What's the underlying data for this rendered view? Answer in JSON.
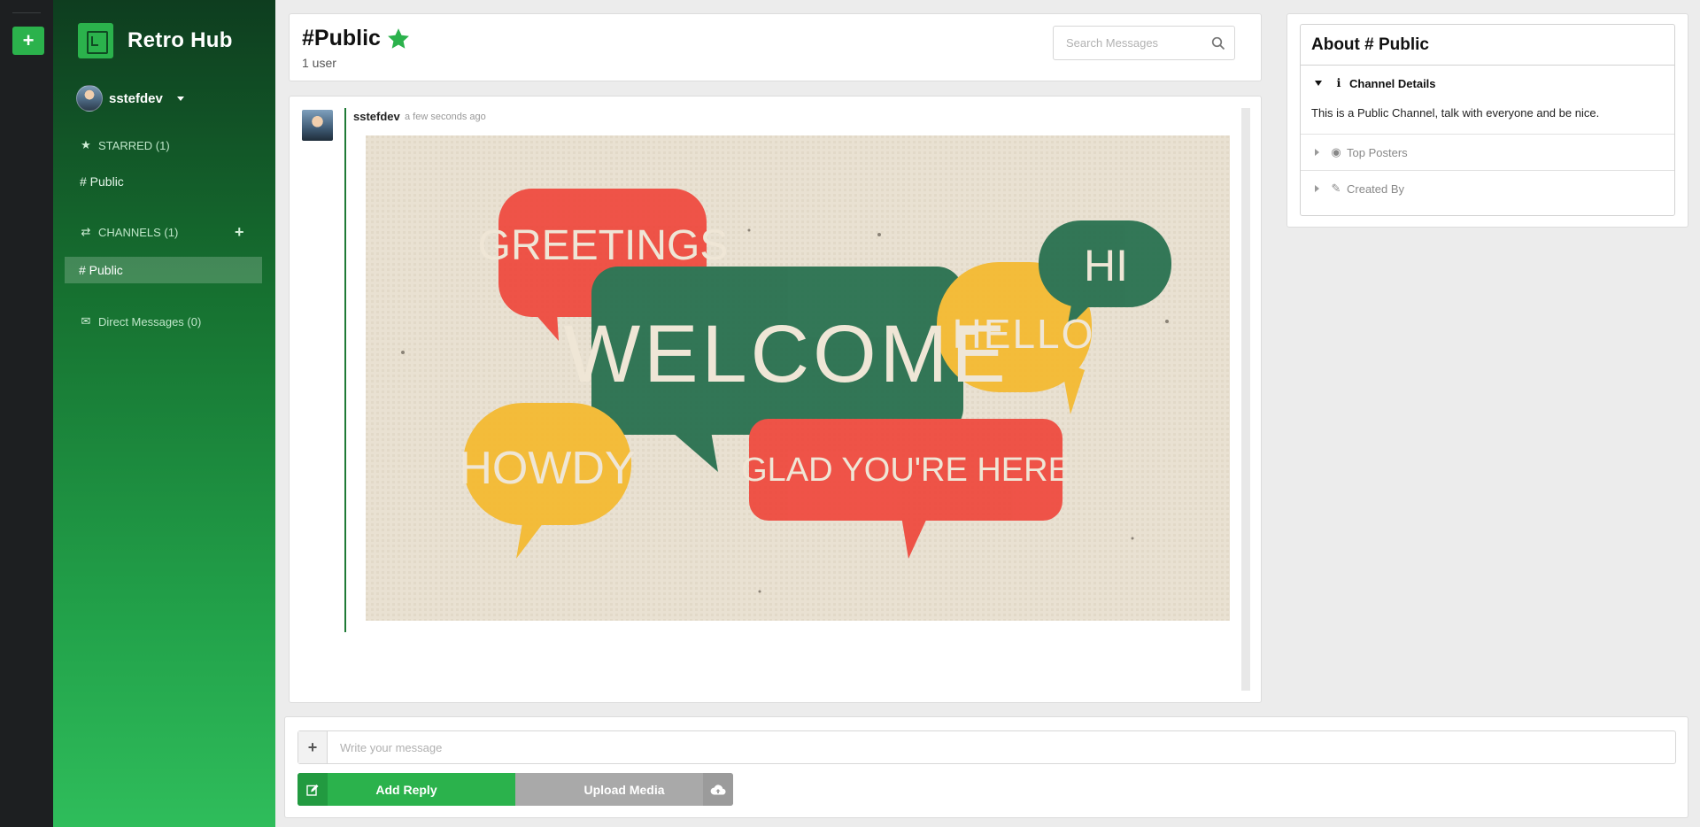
{
  "app": {
    "name": "Retro Hub"
  },
  "rail": {
    "add_label": "+"
  },
  "sidebar": {
    "user": {
      "name": "sstefdev"
    },
    "starred": {
      "label": "STARRED (1)",
      "items": [
        {
          "label": "# Public"
        }
      ]
    },
    "channels": {
      "label": "CHANNELS (1)",
      "add_label": "+",
      "items": [
        {
          "label": "# Public",
          "active": true
        }
      ]
    },
    "direct_messages": {
      "label": "Direct Messages (0)"
    }
  },
  "channel": {
    "title": "#Public",
    "user_count": "1 user",
    "starred": true,
    "accent_color": "#2bb24c"
  },
  "search": {
    "placeholder": "Search Messages"
  },
  "messages": [
    {
      "author": "sstefdev",
      "time": "a few seconds ago",
      "image_words": [
        "GREETINGS",
        "WELCOME",
        "HELLO",
        "HI",
        "HOWDY",
        "GLAD YOU'RE HERE"
      ]
    }
  ],
  "about": {
    "title": "About # Public",
    "sections": [
      {
        "label": "Channel Details",
        "icon": "info-icon",
        "open": true,
        "body": "This is a Public Channel, talk with everyone and be nice."
      },
      {
        "label": "Top Posters",
        "icon": "user-circle-icon",
        "open": false
      },
      {
        "label": "Created By",
        "icon": "pencil-icon",
        "open": false
      }
    ]
  },
  "composer": {
    "placeholder": "Write your message",
    "reply_label": "Add Reply",
    "upload_label": "Upload Media"
  },
  "colors": {
    "brand_green": "#2bb24c",
    "sidebar_dark": "#0e3d1f",
    "upload_gray": "#a9a9a9"
  }
}
